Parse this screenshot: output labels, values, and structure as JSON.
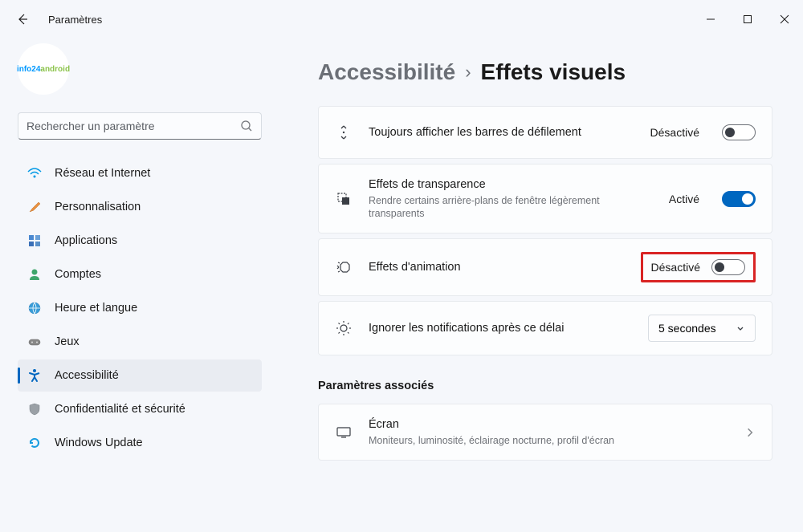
{
  "app_title": "Paramètres",
  "avatar_text": "info24android",
  "search": {
    "placeholder": "Rechercher un paramètre"
  },
  "sidebar": {
    "items": [
      {
        "label": "Réseau et Internet"
      },
      {
        "label": "Personnalisation"
      },
      {
        "label": "Applications"
      },
      {
        "label": "Comptes"
      },
      {
        "label": "Heure et langue"
      },
      {
        "label": "Jeux"
      },
      {
        "label": "Accessibilité"
      },
      {
        "label": "Confidentialité et sécurité"
      },
      {
        "label": "Windows Update"
      }
    ]
  },
  "breadcrumb": {
    "parent": "Accessibilité",
    "separator": "›",
    "current": "Effets visuels"
  },
  "cards": {
    "scrollbars": {
      "title": "Toujours afficher les barres de défilement",
      "status": "Désactivé"
    },
    "transparency": {
      "title": "Effets de transparence",
      "subtitle": "Rendre certains arrière-plans de fenêtre légèrement transparents",
      "status": "Activé"
    },
    "animation": {
      "title": "Effets d'animation",
      "status": "Désactivé"
    },
    "notifications": {
      "title": "Ignorer les notifications après ce délai",
      "value": "5 secondes"
    }
  },
  "related": {
    "heading": "Paramètres associés",
    "screen": {
      "title": "Écran",
      "subtitle": "Moniteurs, luminosité, éclairage nocturne, profil d'écran"
    }
  }
}
